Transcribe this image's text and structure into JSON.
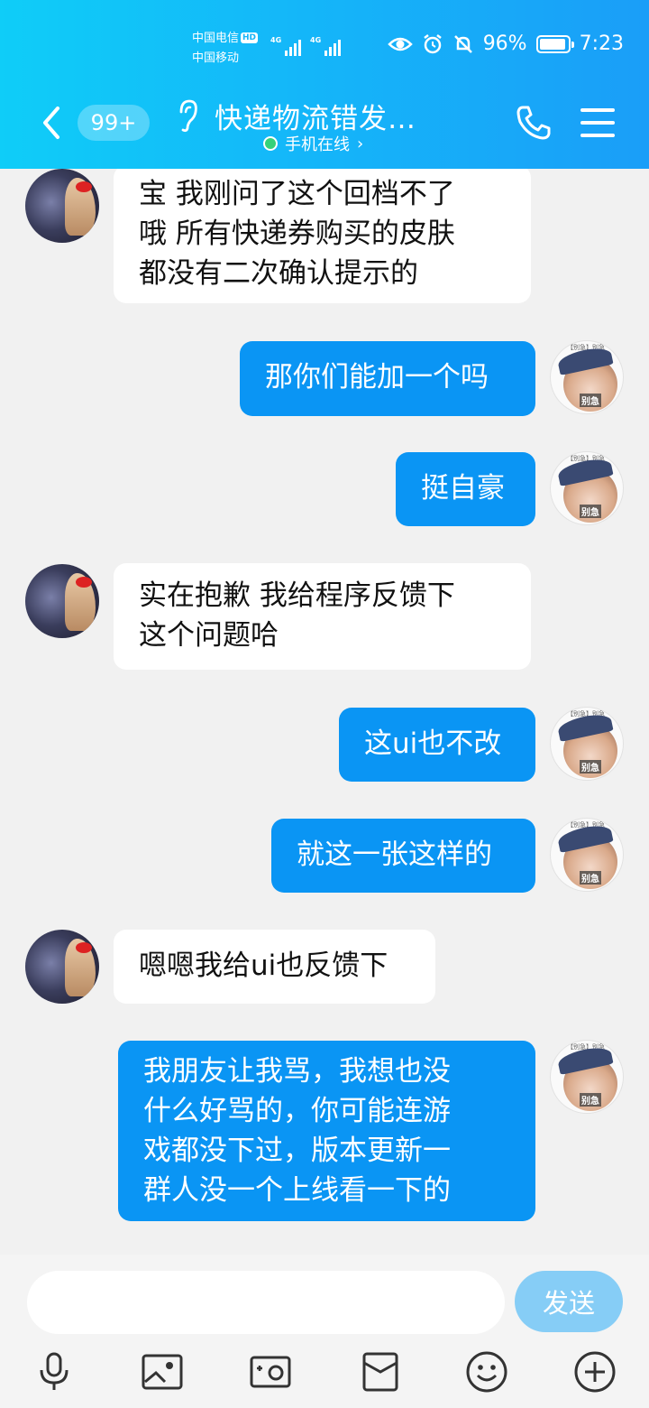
{
  "status_bar": {
    "carrier_1": "中国电信",
    "hd": "HD",
    "carrier_2": "中国移动",
    "signal_1": "4G",
    "signal_2": "4G",
    "battery": "96%",
    "time": "7:23",
    "battery_level": 0.96
  },
  "header": {
    "unread_count": "99+",
    "title": "快递物流错发…",
    "presence": "手机在线",
    "presence_chevron": "›"
  },
  "messages": [
    {
      "side": "left",
      "lines": [
        "宝 我刚问了这个回档不了",
        "哦 所有快递券购买的皮肤",
        "都没有二次确认提示的"
      ]
    },
    {
      "side": "right",
      "lines": [
        "那你们能加一个吗"
      ]
    },
    {
      "side": "right",
      "lines": [
        "挺自豪"
      ]
    },
    {
      "side": "left",
      "lines": [
        "实在抱歉 我给程序反馈下",
        "这个问题哈"
      ]
    },
    {
      "side": "right",
      "lines": [
        "这ui也不改"
      ]
    },
    {
      "side": "right",
      "lines": [
        "就这一张这样的"
      ]
    },
    {
      "side": "left",
      "lines": [
        "嗯嗯我给ui也反馈下"
      ]
    },
    {
      "side": "right",
      "lines": [
        "我朋友让我骂，我想也没",
        "什么好骂的，你可能连游",
        "戏都没下过，版本更新一",
        "群人没一个上线看一下的"
      ]
    }
  ],
  "avatar_right": {
    "tag": "【别急】别急",
    "stamp": "别急"
  },
  "input": {
    "value": "",
    "send_label": "发送"
  },
  "toolbar": [
    "microphone-icon",
    "image-icon",
    "camera-icon",
    "red-packet-icon",
    "emoji-icon",
    "plus-icon"
  ]
}
